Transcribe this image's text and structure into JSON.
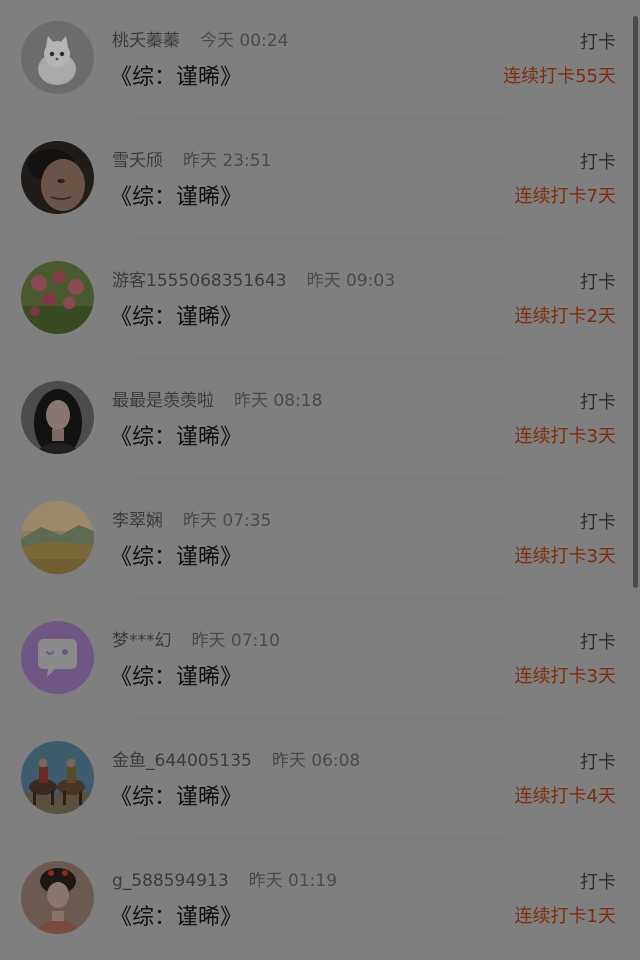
{
  "entries": [
    {
      "name": "桃夭蓁蓁",
      "time": "今天 00:24",
      "title": "《综：谨晞》",
      "action": "打卡",
      "streak": "连续打卡55天",
      "avatar": "white-kitten-avatar"
    },
    {
      "name": "雪夭颀",
      "time": "昨天 23:51",
      "title": "《综：谨晞》",
      "action": "打卡",
      "streak": "连续打卡7天",
      "avatar": "man-portrait-avatar"
    },
    {
      "name": "游客1555068351643",
      "time": "昨天 09:03",
      "title": "《综：谨晞》",
      "action": "打卡",
      "streak": "连续打卡2天",
      "avatar": "red-flowers-avatar"
    },
    {
      "name": "最最是羡羡啦",
      "time": "昨天 08:18",
      "title": "《综：谨晞》",
      "action": "打卡",
      "streak": "连续打卡3天",
      "avatar": "woman-portrait-avatar"
    },
    {
      "name": "李翠娴",
      "time": "昨天 07:35",
      "title": "《综：谨晞》",
      "action": "打卡",
      "streak": "连续打卡3天",
      "avatar": "landscape-avatar"
    },
    {
      "name": "梦***幻",
      "time": "昨天 07:10",
      "title": "《综：谨晞》",
      "action": "打卡",
      "streak": "连续打卡3天",
      "avatar": "default-chat-bubble-avatar"
    },
    {
      "name": "金鱼_644005135",
      "time": "昨天 06:08",
      "title": "《综：谨晞》",
      "action": "打卡",
      "streak": "连续打卡4天",
      "avatar": "horse-riders-avatar"
    },
    {
      "name": "g_588594913",
      "time": "昨天 01:19",
      "title": "《综：谨晞》",
      "action": "打卡",
      "streak": "连续打卡1天",
      "avatar": "costume-girl-avatar"
    }
  ],
  "colors": {
    "background": "#7f7f7f",
    "streak": "#7e2e0d",
    "default_avatar": "#6e5685"
  }
}
